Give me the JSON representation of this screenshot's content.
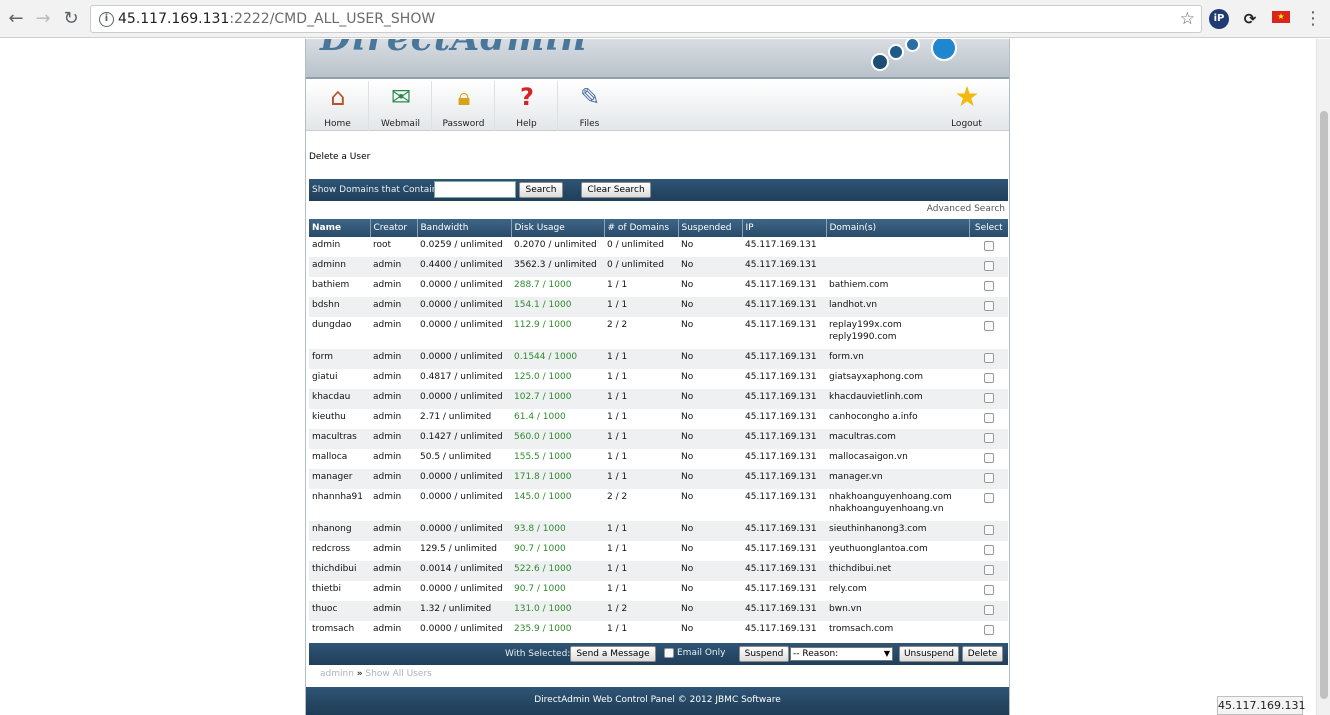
{
  "browser": {
    "url_host": "45.117.169.131",
    "url_rest": ":2222/CMD_ALL_USER_SHOW"
  },
  "toolbar": {
    "items": [
      {
        "label": "Home",
        "icon": "home-icon"
      },
      {
        "label": "Webmail",
        "icon": "webmail-icon"
      },
      {
        "label": "Password",
        "icon": "lock-icon"
      },
      {
        "label": "Help",
        "icon": "help-icon"
      },
      {
        "label": "Files",
        "icon": "files-icon"
      }
    ],
    "logout": "Logout"
  },
  "heading": "Delete a User",
  "search": {
    "label": "Show Domains that Contain",
    "value": "",
    "search_button": "Search",
    "clear_button": "Clear Search",
    "advanced": "Advanced Search"
  },
  "table": {
    "columns": [
      "Name",
      "Creator",
      "Bandwidth",
      "Disk Usage",
      "# of Domains",
      "Suspended",
      "IP",
      "Domain(s)",
      "Select"
    ],
    "rows": [
      {
        "name": "admin",
        "creator": "root",
        "bandwidth": "0.0259 / unlimited",
        "disk": "0.2070 / unlimited",
        "domains_count": "0 / unlimited",
        "suspended": "No",
        "ip": "45.117.169.131",
        "domains": ""
      },
      {
        "name": "adminn",
        "creator": "admin",
        "bandwidth": "0.4400 / unlimited",
        "disk": "3562.3 / unlimited",
        "domains_count": "0 / unlimited",
        "suspended": "No",
        "ip": "45.117.169.131",
        "domains": ""
      },
      {
        "name": "bathiem",
        "creator": "admin",
        "bandwidth": "0.0000 / unlimited",
        "disk": "288.7 / 1000",
        "domains_count": "1 / 1",
        "suspended": "No",
        "ip": "45.117.169.131",
        "domains": "bathiem.com"
      },
      {
        "name": "bdshn",
        "creator": "admin",
        "bandwidth": "0.0000 / unlimited",
        "disk": "154.1 / 1000",
        "domains_count": "1 / 1",
        "suspended": "No",
        "ip": "45.117.169.131",
        "domains": "landhot.vn"
      },
      {
        "name": "dungdao",
        "creator": "admin",
        "bandwidth": "0.0000 / unlimited",
        "disk": "112.9 / 1000",
        "domains_count": "2 / 2",
        "suspended": "No",
        "ip": "45.117.169.131",
        "domains": "replay199x.com",
        "domains2": "reply1990.com"
      },
      {
        "name": "form",
        "creator": "admin",
        "bandwidth": "0.0000 / unlimited",
        "disk": "0.1544 / 1000",
        "domains_count": "1 / 1",
        "suspended": "No",
        "ip": "45.117.169.131",
        "domains": "form.vn"
      },
      {
        "name": "giatui",
        "creator": "admin",
        "bandwidth": "0.4817 / unlimited",
        "disk": "125.0 / 1000",
        "domains_count": "1 / 1",
        "suspended": "No",
        "ip": "45.117.169.131",
        "domains": "giatsayxaphong.com"
      },
      {
        "name": "khacdau",
        "creator": "admin",
        "bandwidth": "0.0000 / unlimited",
        "disk": "102.7 / 1000",
        "domains_count": "1 / 1",
        "suspended": "No",
        "ip": "45.117.169.131",
        "domains": "khacdauvietlinh.com"
      },
      {
        "name": "kieuthu",
        "creator": "admin",
        "bandwidth": "2.71 / unlimited",
        "disk": "61.4 / 1000",
        "domains_count": "1 / 1",
        "suspended": "No",
        "ip": "45.117.169.131",
        "domains": "canhocongho a.info"
      },
      {
        "name": "macultras",
        "creator": "admin",
        "bandwidth": "0.1427 / unlimited",
        "disk": "560.0 / 1000",
        "domains_count": "1 / 1",
        "suspended": "No",
        "ip": "45.117.169.131",
        "domains": "macultras.com"
      },
      {
        "name": "malloca",
        "creator": "admin",
        "bandwidth": "50.5 / unlimited",
        "disk": "155.5 / 1000",
        "domains_count": "1 / 1",
        "suspended": "No",
        "ip": "45.117.169.131",
        "domains": "mallocasaigon.vn"
      },
      {
        "name": "manager",
        "creator": "admin",
        "bandwidth": "0.0000 / unlimited",
        "disk": "171.8 / 1000",
        "domains_count": "1 / 1",
        "suspended": "No",
        "ip": "45.117.169.131",
        "domains": "manager.vn"
      },
      {
        "name": "nhannha91",
        "creator": "admin",
        "bandwidth": "0.0000 / unlimited",
        "disk": "145.0 / 1000",
        "domains_count": "2 / 2",
        "suspended": "No",
        "ip": "45.117.169.131",
        "domains": "nhakhoanguyenhoang.com",
        "domains2": "nhakhoanguyenhoang.vn"
      },
      {
        "name": "nhanong",
        "creator": "admin",
        "bandwidth": "0.0000 / unlimited",
        "disk": "93.8 / 1000",
        "domains_count": "1 / 1",
        "suspended": "No",
        "ip": "45.117.169.131",
        "domains": "sieuthinhanong3.com"
      },
      {
        "name": "redcross",
        "creator": "admin",
        "bandwidth": "129.5 / unlimited",
        "disk": "90.7 / 1000",
        "domains_count": "1 / 1",
        "suspended": "No",
        "ip": "45.117.169.131",
        "domains": "yeuthuonglantoa.com"
      },
      {
        "name": "thichdibui",
        "creator": "admin",
        "bandwidth": "0.0014 / unlimited",
        "disk": "522.6 / 1000",
        "domains_count": "1 / 1",
        "suspended": "No",
        "ip": "45.117.169.131",
        "domains": "thichdibui.net"
      },
      {
        "name": "thietbi",
        "creator": "admin",
        "bandwidth": "0.0000 / unlimited",
        "disk": "90.7 / 1000",
        "domains_count": "1 / 1",
        "suspended": "No",
        "ip": "45.117.169.131",
        "domains": "rely.com"
      },
      {
        "name": "thuoc",
        "creator": "admin",
        "bandwidth": "1.32 / unlimited",
        "disk": "131.0 / 1000",
        "domains_count": "1 / 2",
        "suspended": "No",
        "ip": "45.117.169.131",
        "domains": "bwn.vn"
      },
      {
        "name": "tromsach",
        "creator": "admin",
        "bandwidth": "0.0000 / unlimited",
        "disk": "235.9 / 1000",
        "domains_count": "1 / 1",
        "suspended": "No",
        "ip": "45.117.169.131",
        "domains": "tromsach.com"
      }
    ]
  },
  "actions": {
    "with_selected": "With Selected:",
    "send_message": "Send a Message",
    "email_only": "Email Only",
    "suspend": "Suspend",
    "reason": "-- Reason:",
    "unsuspend": "Unsuspend",
    "delete": "Delete"
  },
  "breadcrumb": {
    "first": "adminn",
    "separator": "»",
    "second": "Show All Users"
  },
  "footer": "DirectAdmin Web Control Panel © 2012 JBMC Software",
  "status_ip": "45.117.169.131",
  "colors": {
    "header_blue": "#2f5575",
    "disk_green": "#2e8b2e"
  }
}
